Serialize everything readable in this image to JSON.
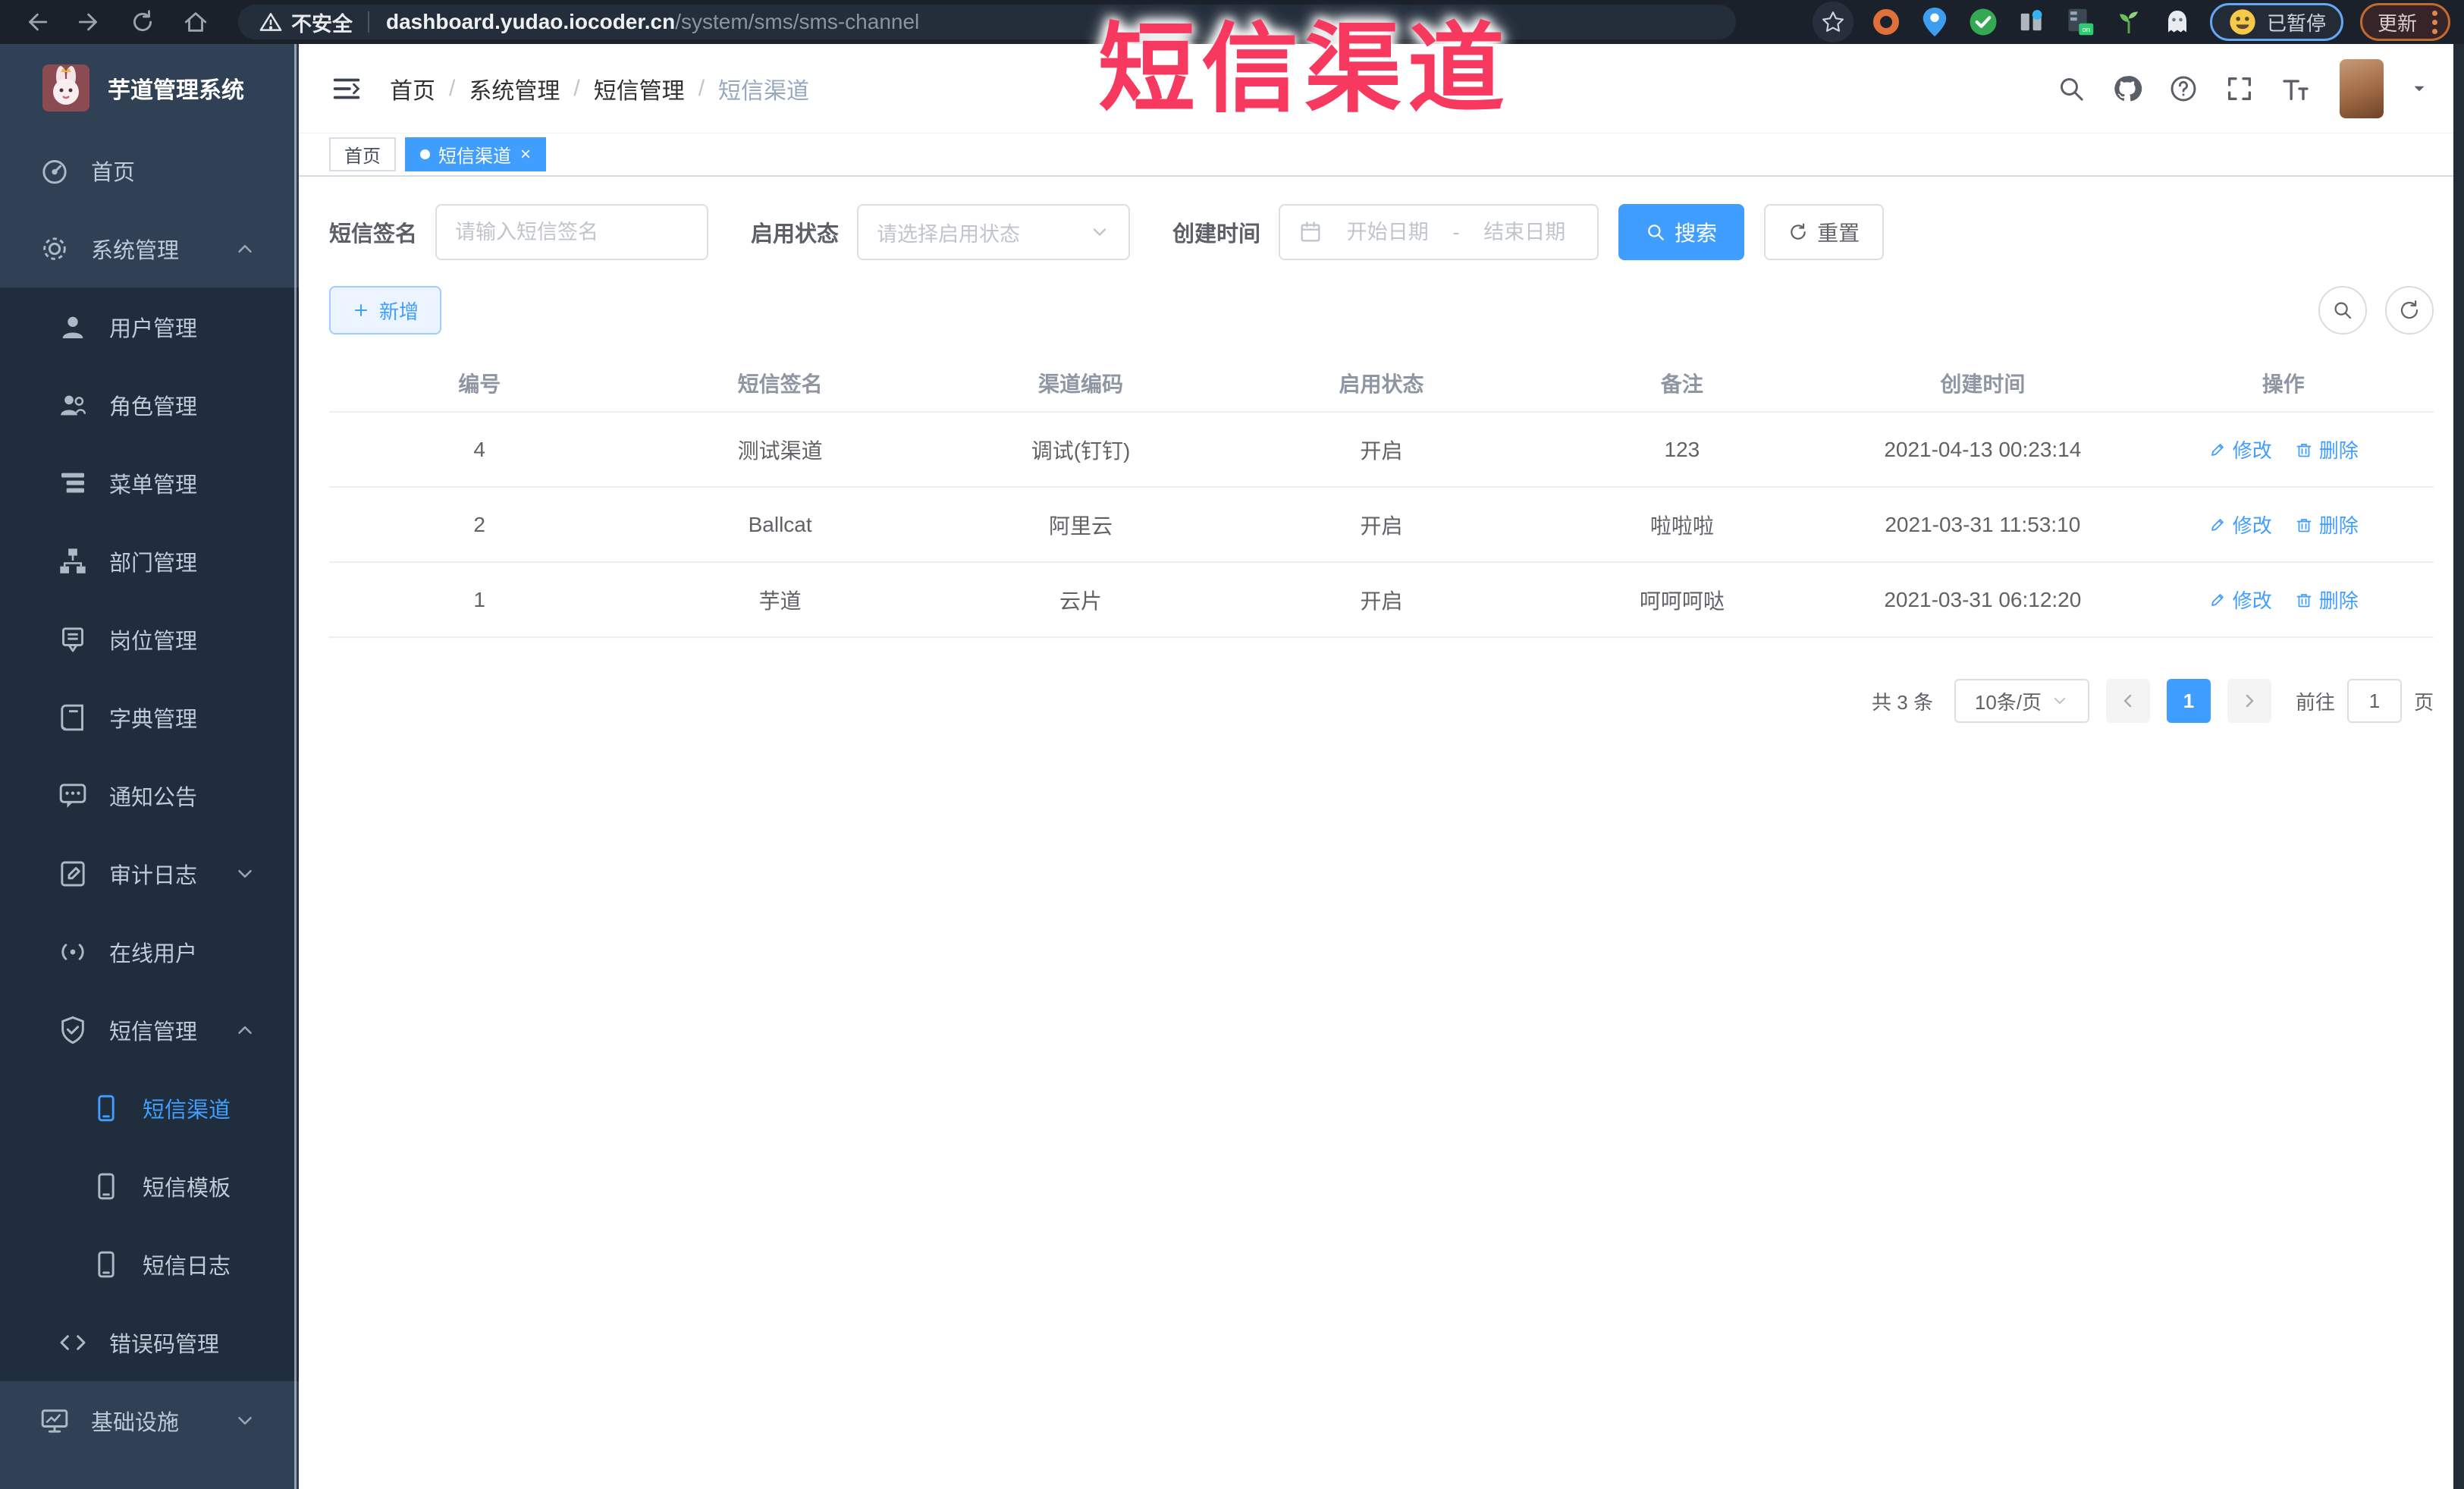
{
  "browser": {
    "security_label": "不安全",
    "url_host": "dashboard.yudao.iocoder.cn",
    "url_path": "/system/sms/sms-channel",
    "paused_badge_label": "已暂停",
    "update_button_label": "更新"
  },
  "annotation": {
    "title": "短信渠道"
  },
  "sidebar": {
    "title": "芋道管理系统",
    "items": [
      {
        "label": "首页",
        "icon": "dashboard-icon",
        "level": 0
      },
      {
        "label": "系统管理",
        "icon": "gear-icon",
        "level": 0,
        "expanded": true
      },
      {
        "label": "用户管理",
        "icon": "user-icon",
        "level": 1
      },
      {
        "label": "角色管理",
        "icon": "peoples-icon",
        "level": 1
      },
      {
        "label": "菜单管理",
        "icon": "tree-table-icon",
        "level": 1
      },
      {
        "label": "部门管理",
        "icon": "tree-icon",
        "level": 1
      },
      {
        "label": "岗位管理",
        "icon": "post-icon",
        "level": 1
      },
      {
        "label": "字典管理",
        "icon": "dict-icon",
        "level": 1
      },
      {
        "label": "通知公告",
        "icon": "message-icon",
        "level": 1
      },
      {
        "label": "审计日志",
        "icon": "log-icon",
        "level": 1,
        "collapsed": true
      },
      {
        "label": "在线用户",
        "icon": "online-icon",
        "level": 1
      },
      {
        "label": "短信管理",
        "icon": "shield-icon",
        "level": 1,
        "expanded": true
      },
      {
        "label": "短信渠道",
        "icon": "phone-icon",
        "level": 2,
        "active": true
      },
      {
        "label": "短信模板",
        "icon": "phone-icon",
        "level": 2
      },
      {
        "label": "短信日志",
        "icon": "phone-icon",
        "level": 2
      },
      {
        "label": "错误码管理",
        "icon": "code-icon",
        "level": 1
      },
      {
        "label": "基础设施",
        "icon": "monitor-icon",
        "level": 0,
        "collapsed": true
      }
    ]
  },
  "breadcrumb": [
    "首页",
    "系统管理",
    "短信管理",
    "短信渠道"
  ],
  "tags": {
    "home_label": "首页",
    "active_label": "短信渠道"
  },
  "filters": {
    "sign_label": "短信签名",
    "sign_placeholder": "请输入短信签名",
    "status_label": "启用状态",
    "status_placeholder": "请选择启用状态",
    "time_label": "创建时间",
    "start_placeholder": "开始日期",
    "range_separator": "-",
    "end_placeholder": "结束日期",
    "search_label": "搜索",
    "reset_label": "重置"
  },
  "toolbar": {
    "add_label": "新增"
  },
  "table": {
    "headers": [
      "编号",
      "短信签名",
      "渠道编码",
      "启用状态",
      "备注",
      "创建时间",
      "操作"
    ],
    "rows": [
      {
        "id": "4",
        "sign": "测试渠道",
        "code": "调试(钉钉)",
        "status": "开启",
        "remark": "123",
        "created": "2021-04-13 00:23:14"
      },
      {
        "id": "2",
        "sign": "Ballcat",
        "code": "阿里云",
        "status": "开启",
        "remark": "啦啦啦",
        "created": "2021-03-31 11:53:10"
      },
      {
        "id": "1",
        "sign": "芋道",
        "code": "云片",
        "status": "开启",
        "remark": "呵呵呵哒",
        "created": "2021-03-31 06:12:20"
      }
    ],
    "edit_label": "修改",
    "delete_label": "删除"
  },
  "pagination": {
    "total": "共 3 条",
    "page_size": "10条/页",
    "current_page": "1",
    "goto_label": "前往",
    "goto_value": "1",
    "page_unit": "页"
  },
  "colors": {
    "accent": "#409eff",
    "annotation_red": "#f8395f",
    "sidebar_bg": "#304156",
    "submenu_bg": "#1f2d3d",
    "chrome_bg": "#1a212b"
  },
  "icons": [
    "back-icon",
    "forward-icon",
    "reload-icon",
    "home-icon",
    "warning-icon",
    "bookmark-star-icon",
    "search-icon",
    "github-icon",
    "help-icon",
    "fullscreen-icon",
    "font-size-icon",
    "calendar-icon",
    "refresh-icon",
    "plus-icon",
    "edit-icon",
    "delete-icon"
  ]
}
